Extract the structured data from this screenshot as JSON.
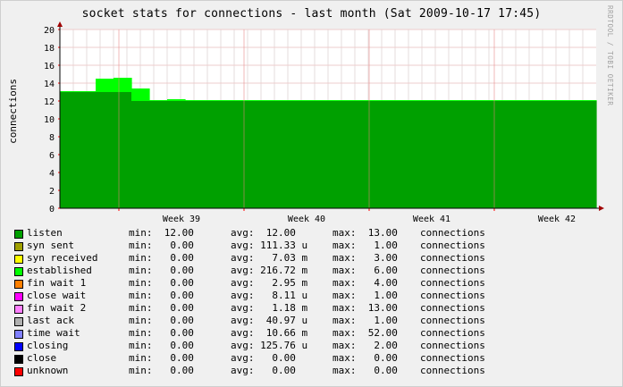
{
  "title": "socket stats for connections - last month (Sat 2009-10-17 17:45)",
  "watermark": "RRDTOOL / TOBI OETIKER",
  "chart_data": {
    "type": "area",
    "title": "socket stats for connections - last month (Sat 2009-10-17 17:45)",
    "ylabel": "connections",
    "ylim": [
      0,
      20
    ],
    "yticks": [
      "0",
      "2",
      "4",
      "6",
      "8",
      "10",
      "12",
      "14",
      "16",
      "18",
      "20"
    ],
    "x_ticks": [
      "Week 39",
      "Week 40",
      "Week 41",
      "Week 42"
    ],
    "grid": true,
    "series": [
      {
        "name": "listen",
        "color": "#00a000",
        "values": [
          13,
          13,
          13,
          13,
          12,
          12,
          12,
          12,
          12,
          12,
          12,
          12,
          12,
          12,
          12,
          12,
          12,
          12,
          12,
          12,
          12,
          12,
          12,
          12,
          12,
          12,
          12,
          12,
          12,
          12
        ]
      },
      {
        "name": "syn sent",
        "color": "#a0a000",
        "values": [
          0,
          0,
          0,
          0,
          0,
          0,
          0,
          0,
          0,
          0,
          0,
          0,
          0,
          0,
          0,
          0,
          0,
          0,
          0,
          0,
          0,
          0,
          0,
          0,
          0,
          0,
          0,
          0,
          0,
          0
        ]
      },
      {
        "name": "syn received",
        "color": "#ffff00",
        "values": [
          0,
          0,
          0,
          0,
          0,
          0,
          0,
          0,
          0,
          0,
          0,
          0,
          0,
          0,
          0,
          0,
          0,
          0,
          0,
          0,
          0,
          0,
          0,
          0,
          0,
          0,
          0,
          0,
          0,
          0
        ]
      },
      {
        "name": "established",
        "color": "#00ff00",
        "values": [
          0.1,
          0.1,
          1.5,
          1.6,
          1.4,
          0.1,
          0.2,
          0.1,
          0.1,
          0.1,
          0.1,
          0.1,
          0.1,
          0.1,
          0.1,
          0.1,
          0.1,
          0.1,
          0.1,
          0.1,
          0.1,
          0.1,
          0.1,
          0.1,
          0.1,
          0.1,
          0.1,
          0.1,
          0.1,
          0.1
        ]
      },
      {
        "name": "fin wait 1",
        "color": "#ff8000",
        "values": [
          0,
          0,
          0,
          0,
          0,
          0,
          0,
          0,
          0,
          0,
          0,
          0,
          0,
          0,
          0,
          0,
          0,
          0,
          0,
          0,
          0,
          0,
          0,
          0,
          0,
          0,
          0,
          0,
          0,
          0
        ]
      },
      {
        "name": "close wait",
        "color": "#ff00ff",
        "values": [
          0,
          0,
          0,
          0,
          0,
          0,
          0,
          0,
          0,
          0,
          0,
          0,
          0,
          0,
          0,
          0,
          0,
          0,
          0,
          0,
          0,
          0,
          0,
          0,
          0,
          0,
          0,
          0,
          0,
          0
        ]
      },
      {
        "name": "fin wait 2",
        "color": "#ff80ff",
        "values": [
          0,
          0,
          0,
          0,
          0,
          0,
          0,
          0,
          0,
          0,
          0,
          0,
          0,
          0,
          0,
          0,
          0,
          0,
          0,
          0,
          0,
          0,
          0,
          0,
          0,
          0,
          0,
          0,
          0,
          0
        ]
      },
      {
        "name": "last ack",
        "color": "#b0b0b0",
        "values": [
          0,
          0,
          0,
          0,
          0,
          0,
          0,
          0,
          0,
          0,
          0,
          0,
          0,
          0,
          0,
          0,
          0,
          0,
          0,
          0,
          0,
          0,
          0,
          0,
          0,
          0,
          0,
          0,
          0,
          0
        ]
      },
      {
        "name": "time wait",
        "color": "#8080ff",
        "values": [
          0,
          0,
          0,
          0,
          0,
          0,
          0,
          0,
          0,
          0,
          0,
          0,
          0,
          0,
          0,
          0,
          0,
          0,
          0,
          0,
          0,
          0,
          0,
          0,
          0,
          0,
          0,
          0,
          0,
          0
        ]
      },
      {
        "name": "closing",
        "color": "#0000ff",
        "values": [
          0,
          0,
          0,
          0,
          0,
          0,
          0,
          0,
          0,
          0,
          0,
          0,
          0,
          0,
          0,
          0,
          0,
          0,
          0,
          0,
          0,
          0,
          0,
          0,
          0,
          0,
          0,
          0,
          0,
          0
        ]
      },
      {
        "name": "close",
        "color": "#000000",
        "values": [
          0,
          0,
          0,
          0,
          0,
          0,
          0,
          0,
          0,
          0,
          0,
          0,
          0,
          0,
          0,
          0,
          0,
          0,
          0,
          0,
          0,
          0,
          0,
          0,
          0,
          0,
          0,
          0,
          0,
          0
        ]
      },
      {
        "name": "unknown",
        "color": "#ff0000",
        "values": [
          0,
          0,
          0,
          0,
          0,
          0,
          0,
          0,
          0,
          0,
          0,
          0,
          0,
          0,
          0,
          0,
          0,
          0,
          0,
          0,
          0,
          0,
          0,
          0,
          0,
          0,
          0,
          0,
          0,
          0
        ]
      }
    ]
  },
  "legend": [
    {
      "name": "listen",
      "color": "#00a000",
      "min": "min:  12.00",
      "avg": "avg:  12.00  ",
      "max": "max:  13.00",
      "unit": "connections"
    },
    {
      "name": "syn sent",
      "color": "#a0a000",
      "min": "min:   0.00",
      "avg": "avg: 111.33 u",
      "max": "max:   1.00",
      "unit": "connections"
    },
    {
      "name": "syn received",
      "color": "#ffff00",
      "min": "min:   0.00",
      "avg": "avg:   7.03 m",
      "max": "max:   3.00",
      "unit": "connections"
    },
    {
      "name": "established",
      "color": "#00ff00",
      "min": "min:   0.00",
      "avg": "avg: 216.72 m",
      "max": "max:   6.00",
      "unit": "connections"
    },
    {
      "name": "fin wait 1",
      "color": "#ff8000",
      "min": "min:   0.00",
      "avg": "avg:   2.95 m",
      "max": "max:   4.00",
      "unit": "connections"
    },
    {
      "name": "close wait",
      "color": "#ff00ff",
      "min": "min:   0.00",
      "avg": "avg:   8.11 u",
      "max": "max:   1.00",
      "unit": "connections"
    },
    {
      "name": "fin wait 2",
      "color": "#ff80ff",
      "min": "min:   0.00",
      "avg": "avg:   1.18 m",
      "max": "max:  13.00",
      "unit": "connections"
    },
    {
      "name": "last ack",
      "color": "#b0b0b0",
      "min": "min:   0.00",
      "avg": "avg:  40.97 u",
      "max": "max:   1.00",
      "unit": "connections"
    },
    {
      "name": "time wait",
      "color": "#8080ff",
      "min": "min:   0.00",
      "avg": "avg:  10.66 m",
      "max": "max:  52.00",
      "unit": "connections"
    },
    {
      "name": "closing",
      "color": "#0000ff",
      "min": "min:   0.00",
      "avg": "avg: 125.76 u",
      "max": "max:   2.00",
      "unit": "connections"
    },
    {
      "name": "close",
      "color": "#000000",
      "min": "min:   0.00",
      "avg": "avg:   0.00  ",
      "max": "max:   0.00",
      "unit": "connections"
    },
    {
      "name": "unknown",
      "color": "#ff0000",
      "min": "min:   0.00",
      "avg": "avg:   0.00  ",
      "max": "max:   0.00",
      "unit": "connections"
    }
  ]
}
